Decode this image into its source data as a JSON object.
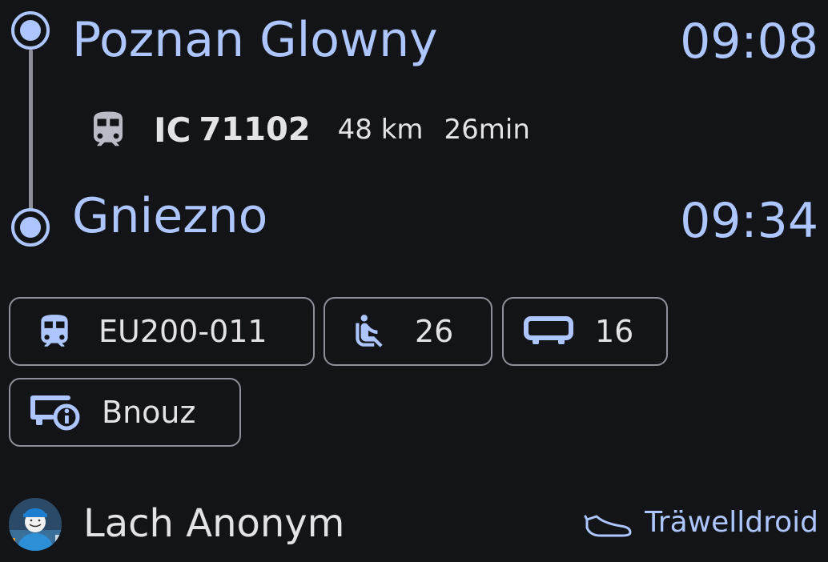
{
  "journey": {
    "origin": {
      "station": "Poznan Glowny",
      "time": "09:08"
    },
    "destination": {
      "station": "Gniezno",
      "time": "09:34"
    },
    "line": {
      "category": "IC",
      "number": "71102"
    },
    "distance": "48 km",
    "duration": "26min"
  },
  "details": {
    "vehicle": "EU200-011",
    "seat": "26",
    "wagon": "16",
    "operator": "Bnouz"
  },
  "footer": {
    "user_name": "Lach Anonym",
    "app_name": "Träwelldroid"
  },
  "icons": {
    "timeline_origin": "radio-dot-icon",
    "timeline_destination": "radio-dot-icon",
    "train": "train-icon",
    "vehicle": "train-icon",
    "seat": "seat-icon",
    "wagon": "wagon-icon",
    "operator": "operator-info-icon",
    "brand": "shoe-icon"
  },
  "colors": {
    "background": "#131418",
    "accent": "#aec6ff",
    "text": "#e3e2e6",
    "outline": "#8e9099"
  }
}
